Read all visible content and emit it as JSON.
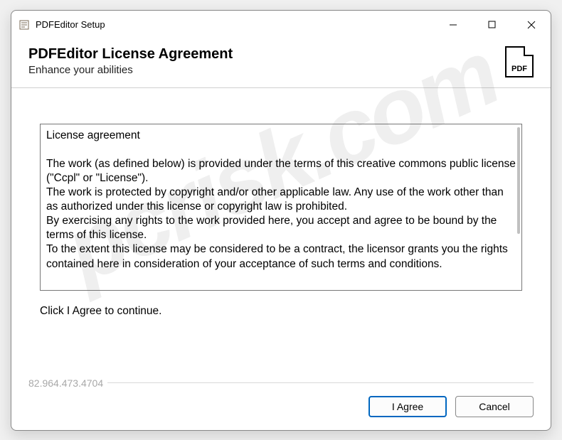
{
  "titlebar": {
    "title": "PDFEditor Setup"
  },
  "header": {
    "heading": "PDFEditor License Agreement",
    "subtitle": "Enhance your abilities",
    "icon_label": "PDF"
  },
  "license": {
    "heading": "License agreement",
    "p1": "The work (as defined below) is provided under the terms of this creative commons public license (\"Ccpl\" or \"License\").",
    "p2": "The work is protected by copyright and/or other applicable law. Any use of the work other than as authorized under this license or copyright law is prohibited.",
    "p3": "By exercising any rights to the work provided here, you accept and agree to be bound by the terms of this license.",
    "p4": "To the extent this license may be considered to be a contract, the licensor grants you the rights contained here in consideration of your acceptance of such terms and conditions."
  },
  "prompt": "Click I Agree to continue.",
  "version": "82.964.473.4704",
  "buttons": {
    "agree": "I Agree",
    "cancel": "Cancel"
  },
  "watermark": "pcrisk.com"
}
